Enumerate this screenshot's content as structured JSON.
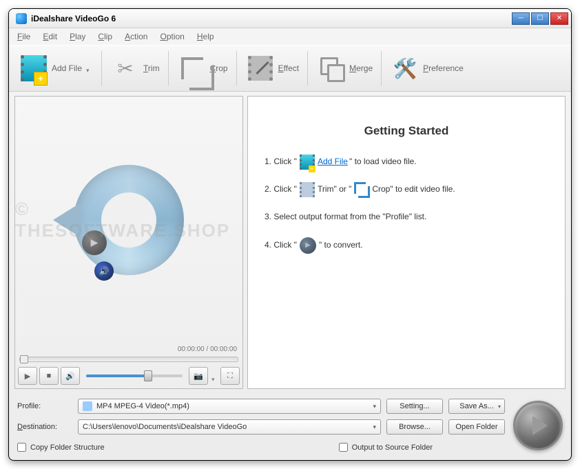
{
  "titlebar": {
    "title": "iDealshare VideoGo 6"
  },
  "menus": {
    "file": "File",
    "edit": "Edit",
    "play": "Play",
    "clip": "Clip",
    "action": "Action",
    "option": "Option",
    "help": "Help"
  },
  "toolbar": {
    "add_file": "Add File",
    "trim": "Trim",
    "crop": "Crop",
    "effect": "Effect",
    "merge": "Merge",
    "preference": "Preference"
  },
  "preview": {
    "time": "00:00:00 / 00:00:00",
    "watermark": "© THESOFTWARE.SHOP"
  },
  "getting_started": {
    "title": "Getting Started",
    "s1a": "1. Click \"",
    "s1_link": " Add File ",
    "s1b": "\" to load video file.",
    "s2a": "2. Click \"",
    "s2_trim": " Trim\" or \"",
    "s2_crop": " Crop\" to edit video file.",
    "s3": "3. Select output format from the \"Profile\" list.",
    "s4a": "4. Click \"",
    "s4b": "\" to convert."
  },
  "profile": {
    "label": "Profile:",
    "value": "MP4 MPEG-4 Video(*.mp4)",
    "setting": "Setting...",
    "save_as": "Save As..."
  },
  "destination": {
    "label": "Destination:",
    "value": "C:\\Users\\lenovo\\Documents\\iDealshare VideoGo",
    "browse": "Browse...",
    "open_folder": "Open Folder"
  },
  "checks": {
    "copy_folder": "Copy Folder Structure",
    "output_source": "Output to Source Folder"
  }
}
